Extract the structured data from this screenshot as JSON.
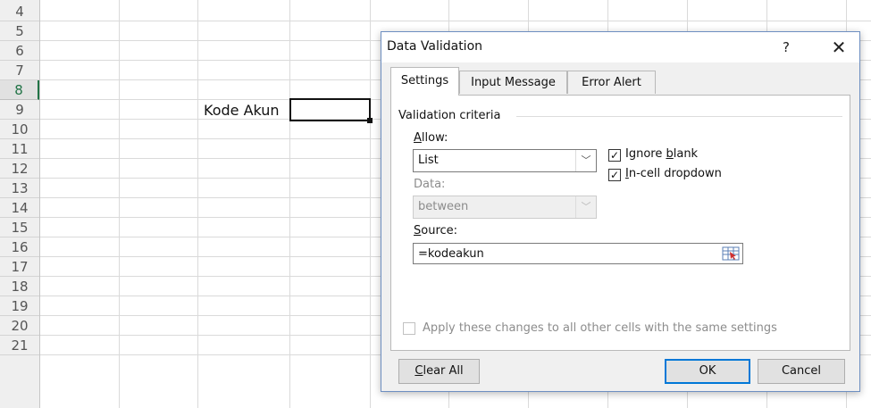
{
  "sheet": {
    "row_numbers": [
      "4",
      "5",
      "6",
      "7",
      "8",
      "9",
      "10",
      "11",
      "12",
      "13",
      "14",
      "15",
      "16",
      "17",
      "18",
      "19",
      "20",
      "21"
    ],
    "selected_row": "8",
    "cell_text": "Kode Akun"
  },
  "dialog": {
    "title": "Data Validation",
    "help": "?",
    "close": "✕",
    "tabs": {
      "settings": "Settings",
      "input_message": "Input Message",
      "error_alert": "Error Alert"
    },
    "validation_criteria": "Validation criteria",
    "allow": {
      "label_prefix": "A",
      "label_rest": "llow:",
      "value": "List"
    },
    "ignore_blank": {
      "prefix": "Ignore ",
      "accel": "b",
      "rest": "lank",
      "checked": true
    },
    "in_cell_dropdown": {
      "accel": "I",
      "rest": "n-cell dropdown",
      "checked": true
    },
    "data": {
      "label": "Data:",
      "value": "between"
    },
    "source": {
      "label_prefix": "S",
      "label_rest": "ource:",
      "value": "=kodeakun"
    },
    "apply_changes": "Apply these changes to all other cells with the same settings",
    "buttons": {
      "clear_all_prefix": "C",
      "clear_all_rest": "lear All",
      "ok": "OK",
      "cancel": "Cancel"
    }
  },
  "colors": {
    "accent": "#0078d7",
    "excel_green": "#217346"
  },
  "icons": {
    "dropdown": "chevron-down-icon",
    "range_selector": "range-selector-icon",
    "check": "check-icon"
  }
}
